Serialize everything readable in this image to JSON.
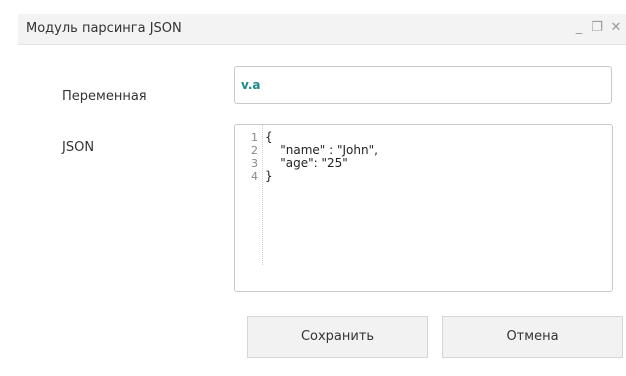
{
  "window": {
    "title": "Модуль парсинга JSON",
    "controls": {
      "minimize_icon": "_",
      "maximize_icon": "❐",
      "close_icon": "✕"
    }
  },
  "form": {
    "variable": {
      "label": "Переменная",
      "value": "v.a"
    },
    "json": {
      "label": "JSON",
      "line_numbers": [
        "1",
        "2",
        "3",
        "4"
      ],
      "lines": [
        "{",
        "    \"name\" : \"John\",",
        "    \"age\": \"25\"",
        "}"
      ]
    }
  },
  "buttons": {
    "save": "Сохранить",
    "cancel": "Отмена"
  },
  "colors": {
    "value_text": "#1a8a8a",
    "titlebar": "#f3f3f3"
  }
}
